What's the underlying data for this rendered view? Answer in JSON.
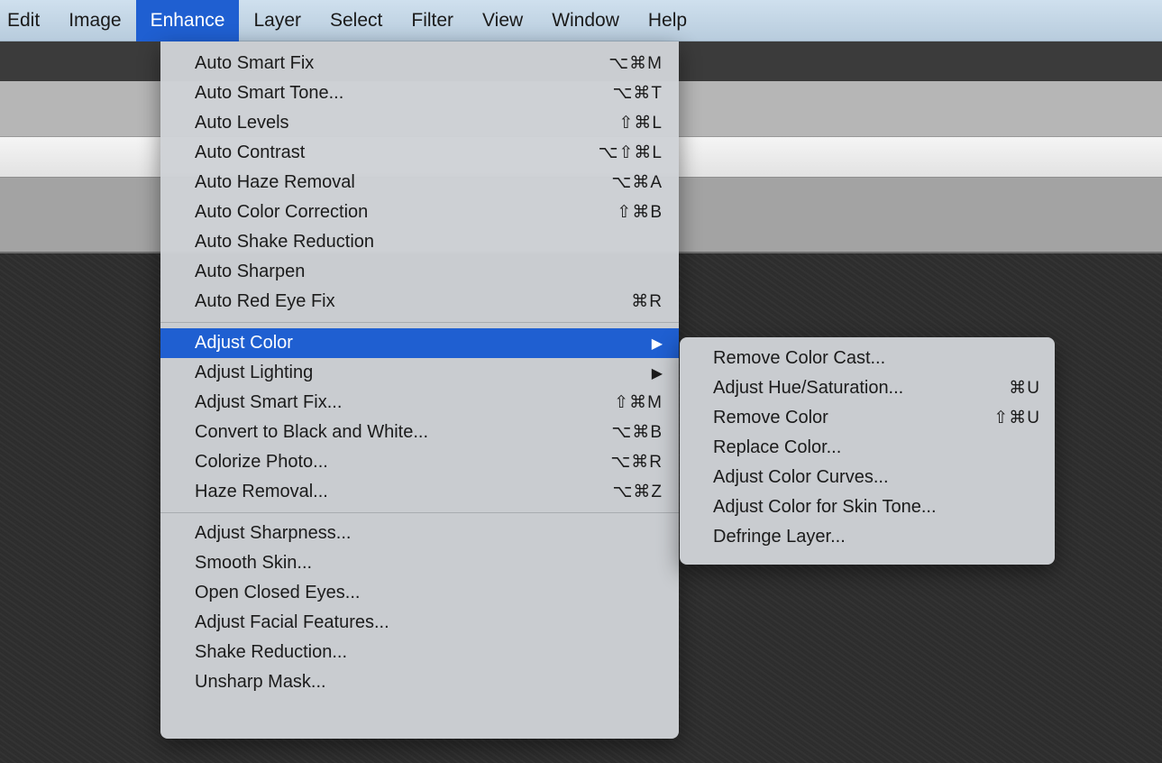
{
  "menubar": {
    "items": [
      "Edit",
      "Image",
      "Enhance",
      "Layer",
      "Select",
      "Filter",
      "View",
      "Window",
      "Help"
    ],
    "active_index": 2
  },
  "enhance_menu": {
    "group1": [
      {
        "label": "Auto Smart Fix",
        "shortcut": "⌥⌘M"
      },
      {
        "label": "Auto Smart Tone...",
        "shortcut": "⌥⌘T"
      },
      {
        "label": "Auto Levels",
        "shortcut": "⇧⌘L"
      },
      {
        "label": "Auto Contrast",
        "shortcut": "⌥⇧⌘L"
      },
      {
        "label": "Auto Haze Removal",
        "shortcut": "⌥⌘A"
      },
      {
        "label": "Auto Color Correction",
        "shortcut": "⇧⌘B"
      },
      {
        "label": "Auto Shake Reduction",
        "shortcut": ""
      },
      {
        "label": "Auto Sharpen",
        "shortcut": ""
      },
      {
        "label": "Auto Red Eye Fix",
        "shortcut": "⌘R"
      }
    ],
    "group2": [
      {
        "label": "Adjust Color",
        "shortcut": "▶",
        "highlighted": true
      },
      {
        "label": "Adjust Lighting",
        "shortcut": "▶"
      },
      {
        "label": "Adjust Smart Fix...",
        "shortcut": "⇧⌘M"
      },
      {
        "label": "Convert to Black and White...",
        "shortcut": "⌥⌘B"
      },
      {
        "label": "Colorize Photo...",
        "shortcut": "⌥⌘R"
      },
      {
        "label": "Haze Removal...",
        "shortcut": "⌥⌘Z"
      }
    ],
    "group3": [
      {
        "label": "Adjust Sharpness...",
        "shortcut": ""
      },
      {
        "label": "Smooth Skin...",
        "shortcut": ""
      },
      {
        "label": "Open Closed Eyes...",
        "shortcut": ""
      },
      {
        "label": "Adjust Facial Features...",
        "shortcut": ""
      },
      {
        "label": "Shake Reduction...",
        "shortcut": ""
      },
      {
        "label": "Unsharp Mask...",
        "shortcut": ""
      }
    ]
  },
  "adjust_color_submenu": [
    {
      "label": "Remove Color Cast...",
      "shortcut": ""
    },
    {
      "label": "Adjust Hue/Saturation...",
      "shortcut": "⌘U"
    },
    {
      "label": "Remove Color",
      "shortcut": "⇧⌘U"
    },
    {
      "label": "Replace Color...",
      "shortcut": ""
    },
    {
      "label": "Adjust Color Curves...",
      "shortcut": ""
    },
    {
      "label": "Adjust Color for Skin Tone...",
      "shortcut": ""
    },
    {
      "label": "Defringe Layer...",
      "shortcut": ""
    }
  ],
  "colors": {
    "highlight": "#1f5fd1",
    "menubar": "#c4d7e7",
    "menu_background": "#ced2d6"
  }
}
